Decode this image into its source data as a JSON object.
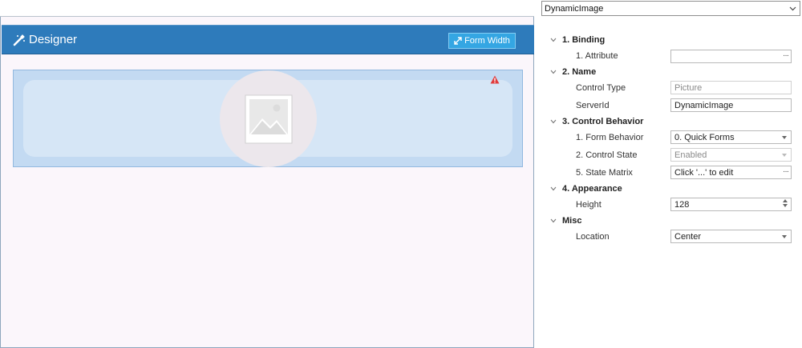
{
  "designer": {
    "title": "Designer",
    "form_width_label": "Form Width",
    "picture_icon": "image-icon",
    "warning_icon": "warning-icon"
  },
  "property_panel": {
    "selected_control": "DynamicImage",
    "sections": [
      {
        "title": "1. Binding",
        "rows": [
          {
            "label": "1. Attribute",
            "value": "",
            "editor": "ellipsis"
          }
        ]
      },
      {
        "title": "2. Name",
        "rows": [
          {
            "label": "Control Type",
            "value": "Picture",
            "editor": "readonly"
          },
          {
            "label": "ServerId",
            "value": "DynamicImage",
            "editor": "text"
          }
        ]
      },
      {
        "title": "3. Control Behavior",
        "rows": [
          {
            "label": "1. Form Behavior",
            "value": "0. Quick Forms",
            "editor": "dropdown"
          },
          {
            "label": "2. Control State",
            "value": "Enabled",
            "editor": "dropdown-disabled"
          },
          {
            "label": "5. State Matrix",
            "value": "Click '...' to edit",
            "editor": "ellipsis"
          }
        ]
      },
      {
        "title": "4. Appearance",
        "rows": [
          {
            "label": "Height",
            "value": "128",
            "editor": "spinner"
          }
        ]
      },
      {
        "title": "Misc",
        "rows": [
          {
            "label": "Location",
            "value": "Center",
            "editor": "dropdown"
          }
        ]
      }
    ]
  },
  "colors": {
    "header_blue": "#2e7bbb",
    "button_blue": "#34a6e3",
    "picture_bg": "#c3daf2",
    "canvas_bg": "#fbf6fb",
    "warning_red": "#e03a3a"
  }
}
